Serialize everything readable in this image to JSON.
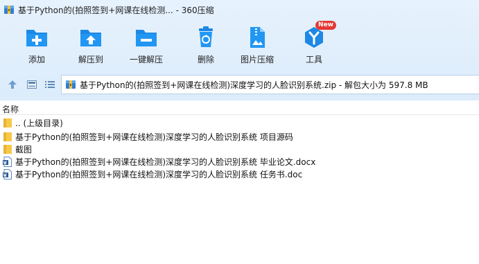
{
  "window": {
    "title": "基于Python的(拍照签到+网课在线检测... - 360压缩"
  },
  "toolbar": {
    "items": [
      {
        "label": "添加",
        "icon": "add-file-icon"
      },
      {
        "label": "解压到",
        "icon": "extract-to-icon"
      },
      {
        "label": "一键解压",
        "icon": "one-click-extract-icon"
      },
      {
        "label": "删除",
        "icon": "delete-icon"
      },
      {
        "label": "图片压缩",
        "icon": "image-compress-icon"
      },
      {
        "label": "工具",
        "icon": "tools-icon",
        "badge": "New"
      }
    ]
  },
  "navbar": {
    "path": "基于Python的(拍照签到+网课在线检测)深度学习的人脸识别系统.zip - 解包大小为 597.8 MB"
  },
  "list": {
    "column_name": "名称",
    "items": [
      {
        "name": ".. (上级目录)",
        "type": "folder"
      },
      {
        "name": "基于Python的(拍照签到+网课在线检测)深度学习的人脸识别系统 项目源码",
        "type": "folder"
      },
      {
        "name": "截图",
        "type": "folder"
      },
      {
        "name": "基于Python的(拍照签到+网课在线检测)深度学习的人脸识别系统 毕业论文.docx",
        "type": "word"
      },
      {
        "name": "基于Python的(拍照签到+网课在线检测)深度学习的人脸识别系统 任务书.doc",
        "type": "word"
      }
    ]
  },
  "colors": {
    "toolbar_bg": "#dcecfb",
    "icon_blue": "#1e88e5",
    "folder_yellow": "#f7c948",
    "badge_red": "#e53935"
  }
}
